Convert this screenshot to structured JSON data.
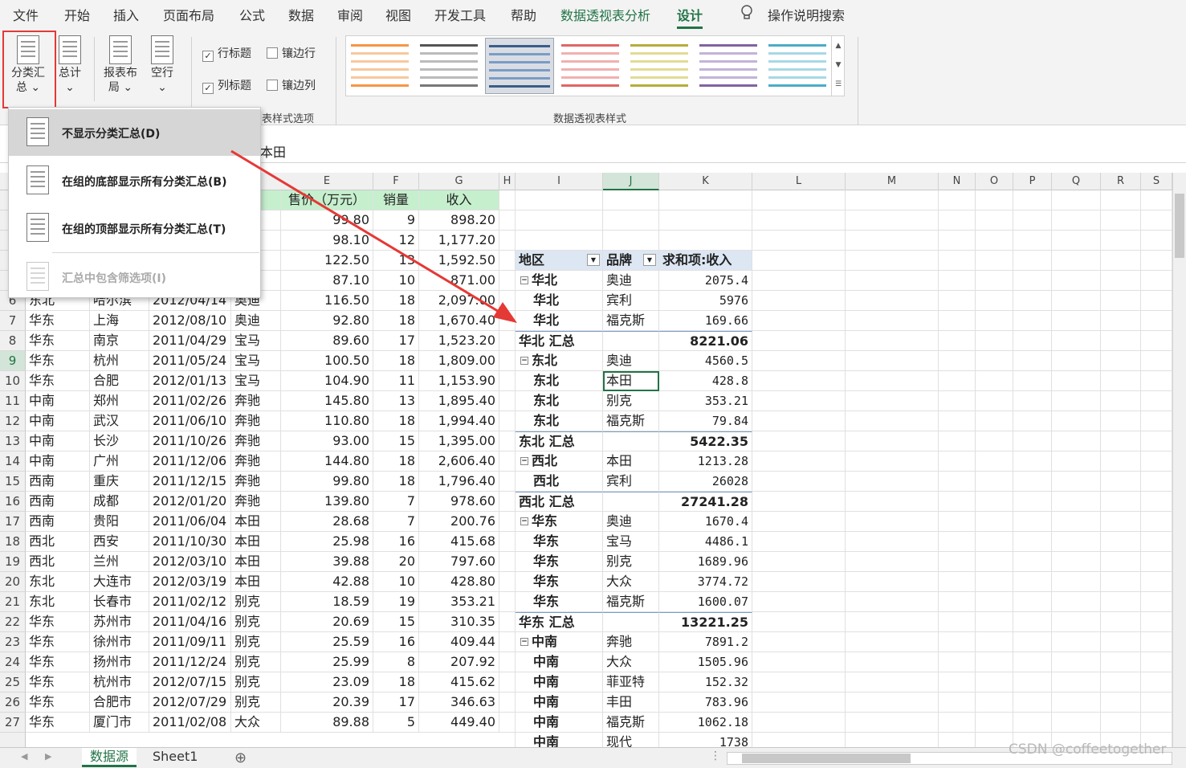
{
  "tabs": {
    "file": "文件",
    "home": "开始",
    "insert": "插入",
    "layout": "页面布局",
    "formulas": "公式",
    "data": "数据",
    "review": "审阅",
    "view": "视图",
    "developer": "开发工具",
    "help": "帮助",
    "pivot_analyze": "数据透视表分析",
    "design": "设计",
    "search_hint": "操作说明搜索"
  },
  "ribbon": {
    "subtotal_l1": "分类汇",
    "subtotal_l2": "总",
    "grandtotal": "总计",
    "report_l1": "报表布",
    "report_l2": "局",
    "blank": "空行",
    "row_headers": "行标题",
    "banded_rows": "镶边行",
    "col_headers": "列标题",
    "banded_cols": "镶边列",
    "options_group": "表样式选项",
    "styles_group": "数据透视表样式",
    "style_colors": [
      "#f79646",
      "#7f7f7f",
      "#4f81bd",
      "#e06666",
      "#c4bd4a",
      "#8064a2",
      "#4bacc6"
    ]
  },
  "formula_value": "本田",
  "dropdown": {
    "item1": "不显示分类汇总(D)",
    "item2": "在组的底部显示所有分类汇总(B)",
    "item3": "在组的顶部显示所有分类汇总(T)",
    "item4": "汇总中包含筛选项(I)"
  },
  "columns": [
    "E",
    "F",
    "G",
    "H",
    "I",
    "J",
    "K",
    "L",
    "M",
    "N",
    "O",
    "P",
    "Q",
    "R",
    "S"
  ],
  "data_header": {
    "brand_tail": "牌",
    "price": "售价（万元）",
    "qty": "销量",
    "income": "收入"
  },
  "top_rows": [
    {
      "n": "",
      "price": "99.80",
      "qty": "9",
      "inc": "898.20"
    },
    {
      "n": "",
      "price": "98.10",
      "qty": "12",
      "inc": "1,177.20"
    },
    {
      "n": "",
      "price": "122.50",
      "qty": "13",
      "inc": "1,592.50"
    },
    {
      "n": "",
      "price": "87.10",
      "qty": "10",
      "inc": "871.00"
    }
  ],
  "rows": [
    {
      "n": "6",
      "reg": "东北",
      "city": "哈尔滨",
      "date": "2012/04/14",
      "brand": "奥迪",
      "price": "116.50",
      "qty": "18",
      "inc": "2,097.00"
    },
    {
      "n": "7",
      "reg": "华东",
      "city": "上海",
      "date": "2012/08/10",
      "brand": "奥迪",
      "price": "92.80",
      "qty": "18",
      "inc": "1,670.40"
    },
    {
      "n": "8",
      "reg": "华东",
      "city": "南京",
      "date": "2011/04/29",
      "brand": "宝马",
      "price": "89.60",
      "qty": "17",
      "inc": "1,523.20"
    },
    {
      "n": "9",
      "reg": "华东",
      "city": "杭州",
      "date": "2011/05/24",
      "brand": "宝马",
      "price": "100.50",
      "qty": "18",
      "inc": "1,809.00"
    },
    {
      "n": "10",
      "reg": "华东",
      "city": "合肥",
      "date": "2012/01/13",
      "brand": "宝马",
      "price": "104.90",
      "qty": "11",
      "inc": "1,153.90"
    },
    {
      "n": "11",
      "reg": "中南",
      "city": "郑州",
      "date": "2011/02/26",
      "brand": "奔驰",
      "price": "145.80",
      "qty": "13",
      "inc": "1,895.40"
    },
    {
      "n": "12",
      "reg": "中南",
      "city": "武汉",
      "date": "2011/06/10",
      "brand": "奔驰",
      "price": "110.80",
      "qty": "18",
      "inc": "1,994.40"
    },
    {
      "n": "13",
      "reg": "中南",
      "city": "长沙",
      "date": "2011/10/26",
      "brand": "奔驰",
      "price": "93.00",
      "qty": "15",
      "inc": "1,395.00"
    },
    {
      "n": "14",
      "reg": "中南",
      "city": "广州",
      "date": "2011/12/06",
      "brand": "奔驰",
      "price": "144.80",
      "qty": "18",
      "inc": "2,606.40"
    },
    {
      "n": "15",
      "reg": "西南",
      "city": "重庆",
      "date": "2011/12/15",
      "brand": "奔驰",
      "price": "99.80",
      "qty": "18",
      "inc": "1,796.40"
    },
    {
      "n": "16",
      "reg": "西南",
      "city": "成都",
      "date": "2012/01/20",
      "brand": "奔驰",
      "price": "139.80",
      "qty": "7",
      "inc": "978.60"
    },
    {
      "n": "17",
      "reg": "西南",
      "city": "贵阳",
      "date": "2011/06/04",
      "brand": "本田",
      "price": "28.68",
      "qty": "7",
      "inc": "200.76"
    },
    {
      "n": "18",
      "reg": "西北",
      "city": "西安",
      "date": "2011/10/30",
      "brand": "本田",
      "price": "25.98",
      "qty": "16",
      "inc": "415.68"
    },
    {
      "n": "19",
      "reg": "西北",
      "city": "兰州",
      "date": "2012/03/10",
      "brand": "本田",
      "price": "39.88",
      "qty": "20",
      "inc": "797.60"
    },
    {
      "n": "20",
      "reg": "东北",
      "city": "大连市",
      "date": "2012/03/19",
      "brand": "本田",
      "price": "42.88",
      "qty": "10",
      "inc": "428.80"
    },
    {
      "n": "21",
      "reg": "东北",
      "city": "长春市",
      "date": "2011/02/12",
      "brand": "别克",
      "price": "18.59",
      "qty": "19",
      "inc": "353.21"
    },
    {
      "n": "22",
      "reg": "华东",
      "city": "苏州市",
      "date": "2011/04/16",
      "brand": "别克",
      "price": "20.69",
      "qty": "15",
      "inc": "310.35"
    },
    {
      "n": "23",
      "reg": "华东",
      "city": "徐州市",
      "date": "2011/09/11",
      "brand": "别克",
      "price": "25.59",
      "qty": "16",
      "inc": "409.44"
    },
    {
      "n": "24",
      "reg": "华东",
      "city": "扬州市",
      "date": "2011/12/24",
      "brand": "别克",
      "price": "25.99",
      "qty": "8",
      "inc": "207.92"
    },
    {
      "n": "25",
      "reg": "华东",
      "city": "杭州市",
      "date": "2012/07/15",
      "brand": "别克",
      "price": "23.09",
      "qty": "18",
      "inc": "415.62"
    },
    {
      "n": "26",
      "reg": "华东",
      "city": "合肥市",
      "date": "2012/07/29",
      "brand": "别克",
      "price": "20.39",
      "qty": "17",
      "inc": "346.63"
    },
    {
      "n": "27",
      "reg": "华东",
      "city": "厦门市",
      "date": "2011/02/08",
      "brand": "大众",
      "price": "89.88",
      "qty": "5",
      "inc": "449.40"
    }
  ],
  "pivot": {
    "h_region": "地区",
    "h_brand": "品牌",
    "h_sum": "求和项:收入",
    "rows": [
      {
        "t": "first",
        "reg": "华北",
        "brand": "奥迪",
        "val": "2075.4"
      },
      {
        "t": "item",
        "reg": "华北",
        "brand": "宾利",
        "val": "5976"
      },
      {
        "t": "item",
        "reg": "华北",
        "brand": "福克斯",
        "val": "169.66"
      },
      {
        "t": "sum",
        "reg": "华北 汇总",
        "brand": "",
        "val": "8221.06"
      },
      {
        "t": "first",
        "reg": "东北",
        "brand": "奥迪",
        "val": "4560.5"
      },
      {
        "t": "item",
        "reg": "东北",
        "brand": "本田",
        "val": "428.8"
      },
      {
        "t": "item",
        "reg": "东北",
        "brand": "别克",
        "val": "353.21"
      },
      {
        "t": "item",
        "reg": "东北",
        "brand": "福克斯",
        "val": "79.84"
      },
      {
        "t": "sum",
        "reg": "东北 汇总",
        "brand": "",
        "val": "5422.35"
      },
      {
        "t": "first",
        "reg": "西北",
        "brand": "本田",
        "val": "1213.28"
      },
      {
        "t": "item",
        "reg": "西北",
        "brand": "宾利",
        "val": "26028"
      },
      {
        "t": "sum",
        "reg": "西北 汇总",
        "brand": "",
        "val": "27241.28"
      },
      {
        "t": "first",
        "reg": "华东",
        "brand": "奥迪",
        "val": "1670.4"
      },
      {
        "t": "item",
        "reg": "华东",
        "brand": "宝马",
        "val": "4486.1"
      },
      {
        "t": "item",
        "reg": "华东",
        "brand": "别克",
        "val": "1689.96"
      },
      {
        "t": "item",
        "reg": "华东",
        "brand": "大众",
        "val": "3774.72"
      },
      {
        "t": "item",
        "reg": "华东",
        "brand": "福克斯",
        "val": "1600.07"
      },
      {
        "t": "sum",
        "reg": "华东 汇总",
        "brand": "",
        "val": "13221.25"
      },
      {
        "t": "first",
        "reg": "中南",
        "brand": "奔驰",
        "val": "7891.2"
      },
      {
        "t": "item",
        "reg": "中南",
        "brand": "大众",
        "val": "1505.96"
      },
      {
        "t": "item",
        "reg": "中南",
        "brand": "菲亚特",
        "val": "152.32"
      },
      {
        "t": "item",
        "reg": "中南",
        "brand": "丰田",
        "val": "783.96"
      },
      {
        "t": "item",
        "reg": "中南",
        "brand": "福克斯",
        "val": "1062.18"
      },
      {
        "t": "item",
        "reg": "中南",
        "brand": "现代",
        "val": "1738"
      }
    ]
  },
  "sheets": {
    "s1": "数据源",
    "s2": "Sheet1"
  },
  "watermark": "CSDN @coffeetogether",
  "colors": {
    "accent": "#217346",
    "highlight": "#e53935"
  }
}
